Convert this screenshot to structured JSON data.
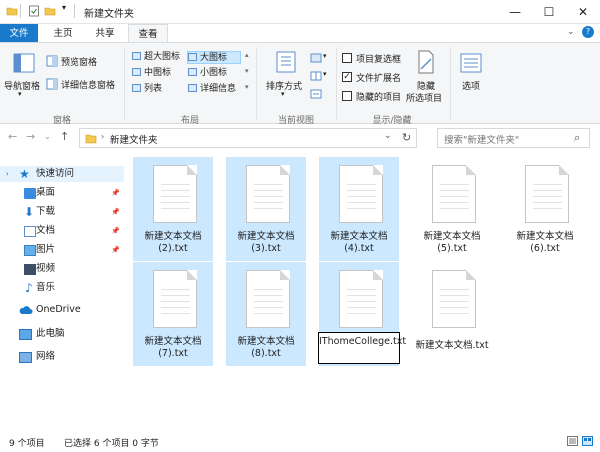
{
  "window": {
    "title": "新建文件夹",
    "minimize_glyph": "—",
    "maximize_glyph": "☐",
    "close_glyph": "✕"
  },
  "tabs": [
    {
      "label": "文件"
    },
    {
      "label": "主页"
    },
    {
      "label": "共享"
    },
    {
      "label": "查看"
    }
  ],
  "ribbon": {
    "pane_group": {
      "nav_pane": "导航窗格",
      "preview_pane": "预览窗格",
      "details_pane": "详细信息窗格",
      "label": "窗格"
    },
    "layout_group": {
      "items": [
        "超大图标",
        "大图标",
        "中图标",
        "小图标",
        "列表",
        "详细信息"
      ],
      "selected": "大图标",
      "label": "布局"
    },
    "current_view_group": {
      "sort_by": "排序方式",
      "label": "当前视图"
    },
    "show_hide_group": {
      "item_checkboxes": "项目复选框",
      "file_extensions": "文件扩展名",
      "hidden_items": "隐藏的项目",
      "hide_selected_line1": "隐藏",
      "hide_selected_line2": "所选项目",
      "label": "显示/隐藏",
      "item_checkboxes_checked": false,
      "file_extensions_checked": true,
      "hidden_items_checked": false
    },
    "options": "选项"
  },
  "address": {
    "path": "新建文件夹",
    "search_placeholder": "搜索\"新建文件夹\""
  },
  "nav_pane": {
    "items": [
      {
        "label": "快速访问",
        "icon": "star-icon"
      },
      {
        "label": "桌面",
        "icon": "desktop-icon",
        "pinned": true
      },
      {
        "label": "下载",
        "icon": "download-icon",
        "pinned": true
      },
      {
        "label": "文档",
        "icon": "document-icon",
        "pinned": true
      },
      {
        "label": "图片",
        "icon": "picture-icon",
        "pinned": true
      },
      {
        "label": "视频",
        "icon": "video-icon"
      },
      {
        "label": "音乐",
        "icon": "music-icon"
      },
      {
        "label": "OneDrive",
        "icon": "cloud-icon"
      },
      {
        "label": "此电脑",
        "icon": "computer-icon"
      },
      {
        "label": "网络",
        "icon": "network-icon"
      }
    ]
  },
  "files": [
    {
      "name": "新建文本文档 (2).txt",
      "selected": true
    },
    {
      "name": "新建文本文档 (3).txt",
      "selected": true
    },
    {
      "name": "新建文本文档 (4).txt",
      "selected": true
    },
    {
      "name": "新建文本文档 (5).txt",
      "selected": false
    },
    {
      "name": "新建文本文档 (6).txt",
      "selected": false
    },
    {
      "name": "新建文本文档 (7).txt",
      "selected": true
    },
    {
      "name": "新建文本文档 (8).txt",
      "selected": true
    },
    {
      "name": "IThomeCollege.txt",
      "selected": true,
      "renaming": true
    },
    {
      "name": "新建文本文档.txt",
      "selected": false
    }
  ],
  "status": {
    "count": "9 个项目",
    "selected": "已选择 6 个项目 0 字节"
  },
  "colors": {
    "accent": "#1979ca",
    "selection": "#cce8ff"
  }
}
